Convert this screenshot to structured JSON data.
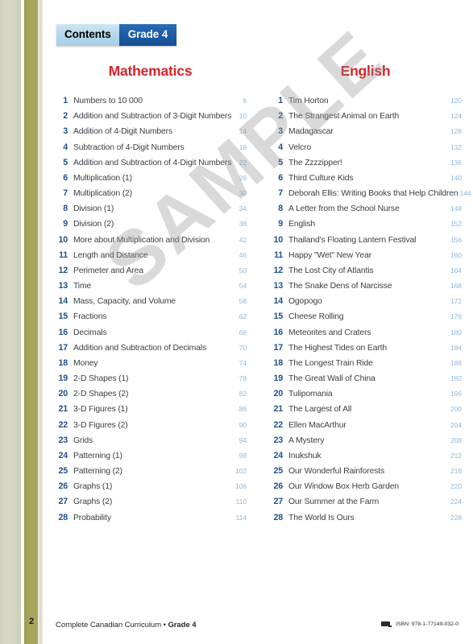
{
  "header": {
    "tab_contents": "Contents",
    "tab_grade": "Grade 4"
  },
  "watermark": {
    "text": "SAMPLE"
  },
  "colors": {
    "title_red": "#d8232a",
    "number_blue": "#1d4f8f",
    "page_blue": "#8fb8dc",
    "tab_dark_blue": "#1a5aa5",
    "tab_light_blue": "#b3d6ea",
    "edge_olive": "#a8a45a",
    "edge_sage": "#d4d4c0"
  },
  "columns": [
    {
      "title": "Mathematics",
      "items": [
        {
          "num": "1",
          "label": "Numbers to 10 000",
          "page": "6"
        },
        {
          "num": "2",
          "label": "Addition and Subtraction of 3-Digit Numbers",
          "page": "10"
        },
        {
          "num": "3",
          "label": "Addition of 4-Digit Numbers",
          "page": "14"
        },
        {
          "num": "4",
          "label": "Subtraction of 4-Digit Numbers",
          "page": "18"
        },
        {
          "num": "5",
          "label": "Addition and Subtraction of 4-Digit Numbers",
          "page": "22"
        },
        {
          "num": "6",
          "label": "Multiplication (1)",
          "page": "26"
        },
        {
          "num": "7",
          "label": "Multiplication (2)",
          "page": "30"
        },
        {
          "num": "8",
          "label": "Division (1)",
          "page": "34"
        },
        {
          "num": "9",
          "label": "Division (2)",
          "page": "38"
        },
        {
          "num": "10",
          "label": "More about Multiplication and Division",
          "page": "42"
        },
        {
          "num": "11",
          "label": "Length and Distance",
          "page": "46"
        },
        {
          "num": "12",
          "label": "Perimeter and Area",
          "page": "50"
        },
        {
          "num": "13",
          "label": "Time",
          "page": "54"
        },
        {
          "num": "14",
          "label": "Mass, Capacity, and Volume",
          "page": "58"
        },
        {
          "num": "15",
          "label": "Fractions",
          "page": "62"
        },
        {
          "num": "16",
          "label": "Decimals",
          "page": "66"
        },
        {
          "num": "17",
          "label": "Addition and Subtraction of Decimals",
          "page": "70"
        },
        {
          "num": "18",
          "label": "Money",
          "page": "74"
        },
        {
          "num": "19",
          "label": "2-D Shapes (1)",
          "page": "78"
        },
        {
          "num": "20",
          "label": "2-D Shapes (2)",
          "page": "82"
        },
        {
          "num": "21",
          "label": "3-D Figures (1)",
          "page": "86"
        },
        {
          "num": "22",
          "label": "3-D Figures (2)",
          "page": "90"
        },
        {
          "num": "23",
          "label": "Grids",
          "page": "94"
        },
        {
          "num": "24",
          "label": "Patterning (1)",
          "page": "98"
        },
        {
          "num": "25",
          "label": "Patterning (2)",
          "page": "102"
        },
        {
          "num": "26",
          "label": "Graphs (1)",
          "page": "106"
        },
        {
          "num": "27",
          "label": "Graphs (2)",
          "page": "110"
        },
        {
          "num": "28",
          "label": "Probability",
          "page": "114"
        }
      ]
    },
    {
      "title": "English",
      "items": [
        {
          "num": "1",
          "label": "Tim Horton",
          "page": "120"
        },
        {
          "num": "2",
          "label": "The Strangest Animal on Earth",
          "page": "124"
        },
        {
          "num": "3",
          "label": "Madagascar",
          "page": "128"
        },
        {
          "num": "4",
          "label": "Velcro",
          "page": "132"
        },
        {
          "num": "5",
          "label": "The Zzzzipper!",
          "page": "136"
        },
        {
          "num": "6",
          "label": "Third Culture Kids",
          "page": "140"
        },
        {
          "num": "7",
          "label": "Deborah Ellis: Writing Books that Help Children",
          "page": "144"
        },
        {
          "num": "8",
          "label": "A Letter from the School Nurse",
          "page": "148"
        },
        {
          "num": "9",
          "label": "English",
          "page": "152"
        },
        {
          "num": "10",
          "label": "Thailand's Floating Lantern Festival",
          "page": "156"
        },
        {
          "num": "11",
          "label": "Happy \"Wet\" New Year",
          "page": "160"
        },
        {
          "num": "12",
          "label": "The Lost City of Atlantis",
          "page": "164"
        },
        {
          "num": "13",
          "label": "The Snake Dens of Narcisse",
          "page": "168"
        },
        {
          "num": "14",
          "label": "Ogopogo",
          "page": "172"
        },
        {
          "num": "15",
          "label": "Cheese Rolling",
          "page": "176"
        },
        {
          "num": "16",
          "label": "Meteorites and Craters",
          "page": "180"
        },
        {
          "num": "17",
          "label": "The Highest Tides on Earth",
          "page": "184"
        },
        {
          "num": "18",
          "label": "The Longest Train Ride",
          "page": "188"
        },
        {
          "num": "19",
          "label": "The Great Wall of China",
          "page": "192"
        },
        {
          "num": "20",
          "label": "Tulipomania",
          "page": "196"
        },
        {
          "num": "21",
          "label": "The Largest of All",
          "page": "200"
        },
        {
          "num": "22",
          "label": "Ellen MacArthur",
          "page": "204"
        },
        {
          "num": "23",
          "label": "A Mystery",
          "page": "208"
        },
        {
          "num": "24",
          "label": "Inukshuk",
          "page": "212"
        },
        {
          "num": "25",
          "label": "Our Wonderful Rainforests",
          "page": "216"
        },
        {
          "num": "26",
          "label": "Our Window Box Herb Garden",
          "page": "220"
        },
        {
          "num": "27",
          "label": "Our Summer at the Farm",
          "page": "224"
        },
        {
          "num": "28",
          "label": "The World Is Ours",
          "page": "228"
        }
      ]
    }
  ],
  "footer": {
    "page_number": "2",
    "title_plain": "Complete Canadian Curriculum • ",
    "title_bold": "Grade 4",
    "isbn": "ISBN: 978-1-77149-032-0"
  }
}
